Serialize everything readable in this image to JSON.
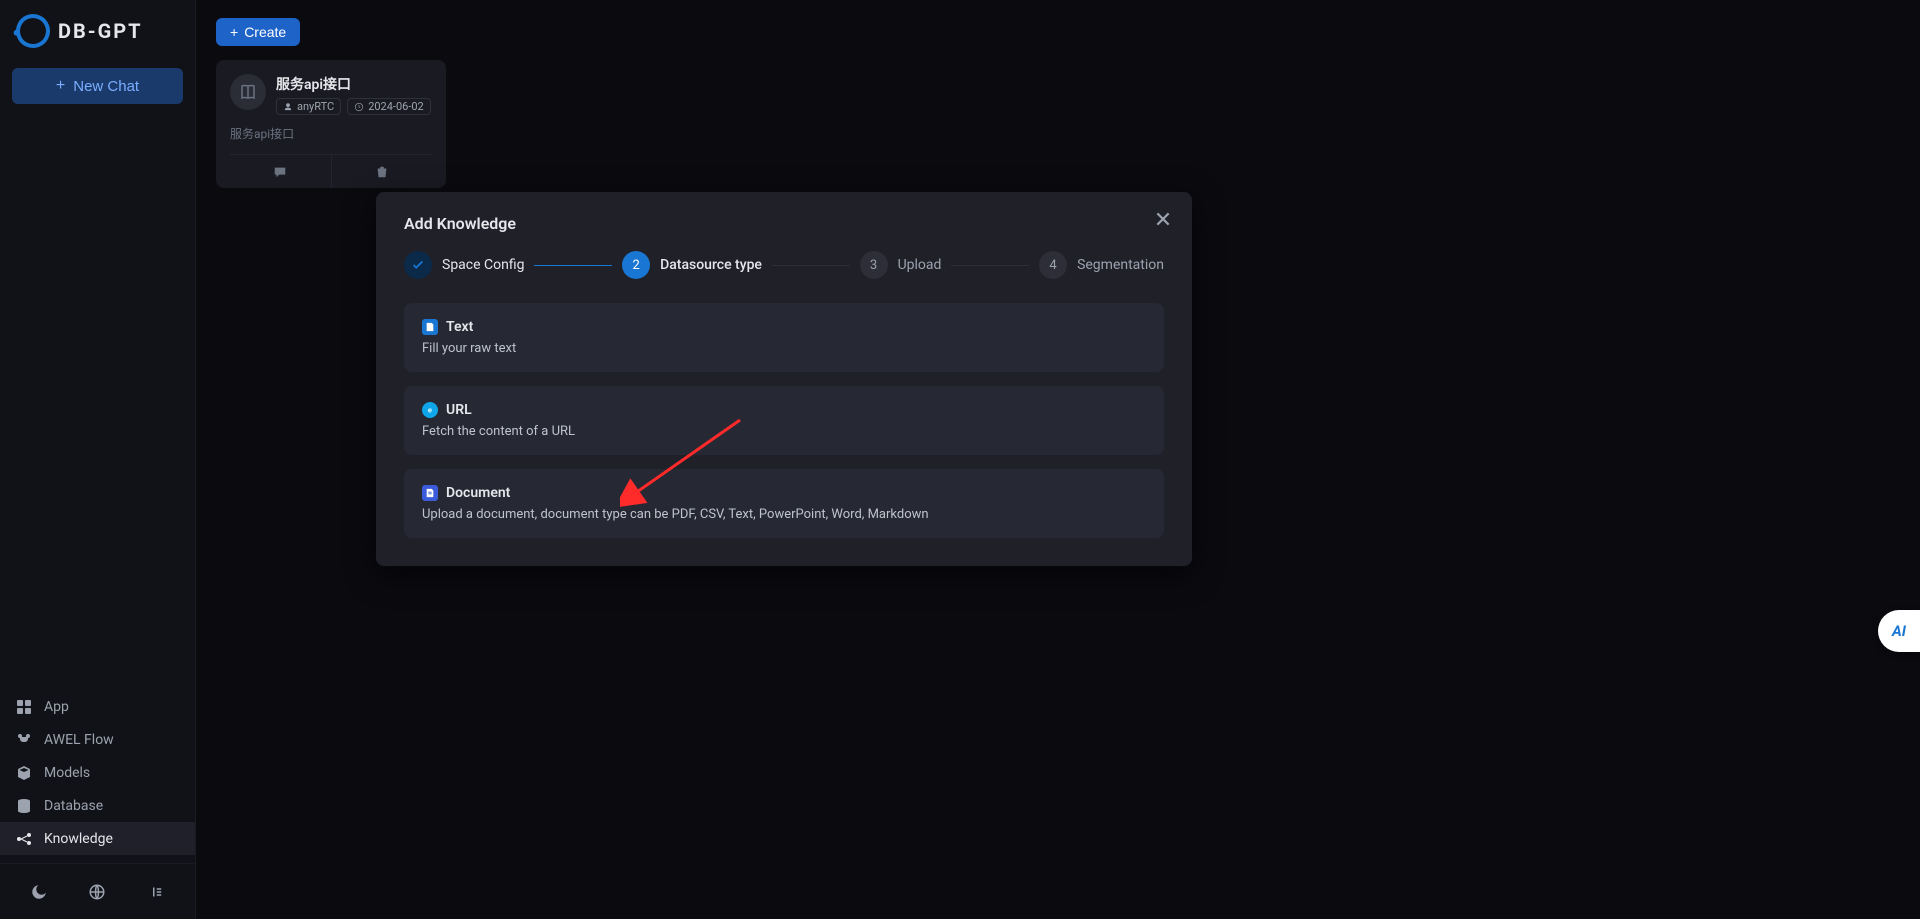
{
  "brand": "DB-GPT",
  "sidebar": {
    "new_chat": "New Chat",
    "nav": [
      {
        "id": "app",
        "label": "App"
      },
      {
        "id": "awel",
        "label": "AWEL Flow"
      },
      {
        "id": "models",
        "label": "Models"
      },
      {
        "id": "database",
        "label": "Database"
      },
      {
        "id": "knowledge",
        "label": "Knowledge"
      }
    ],
    "active_nav": "knowledge"
  },
  "toolbar": {
    "create_label": "Create"
  },
  "card": {
    "title": "服务api接口",
    "author": "anyRTC",
    "date": "2024-06-02",
    "subtitle": "服务api接口"
  },
  "modal": {
    "title": "Add Knowledge",
    "steps": [
      {
        "num": "✓",
        "label": "Space Config",
        "state": "done"
      },
      {
        "num": "2",
        "label": "Datasource type",
        "state": "active"
      },
      {
        "num": "3",
        "label": "Upload",
        "state": "pending"
      },
      {
        "num": "4",
        "label": "Segmentation",
        "state": "pending"
      }
    ],
    "options": [
      {
        "id": "text",
        "title": "Text",
        "desc": "Fill your raw text"
      },
      {
        "id": "url",
        "title": "URL",
        "desc": "Fetch the content of a URL"
      },
      {
        "id": "doc",
        "title": "Document",
        "desc": "Upload a document, document type can be PDF, CSV, Text, PowerPoint, Word, Markdown"
      }
    ]
  },
  "float_label": "AI"
}
